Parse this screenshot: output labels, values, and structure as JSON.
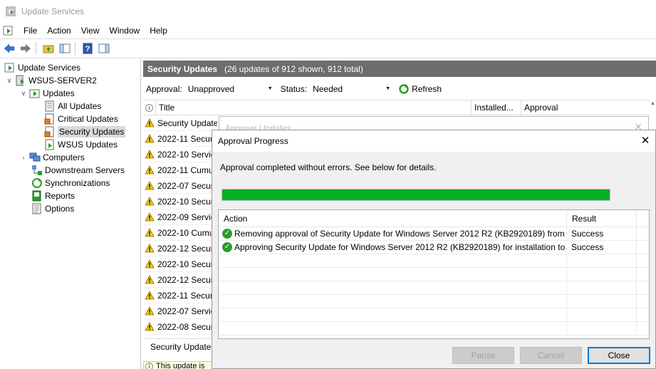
{
  "window": {
    "title": "Update Services"
  },
  "menu": [
    "File",
    "Action",
    "View",
    "Window",
    "Help"
  ],
  "toolbar": {
    "icons": [
      "back-arrow-icon",
      "forward-arrow-icon",
      "up-folder-icon",
      "show-hide-tree-icon",
      "help-icon",
      "show-hide-action-pane-icon"
    ]
  },
  "tree": {
    "root": "Update Services",
    "server": "WSUS-SERVER2",
    "updates": "Updates",
    "all_updates": "All Updates",
    "critical_updates": "Critical Updates",
    "security_updates": "Security Updates",
    "wsus_updates": "WSUS Updates",
    "computers": "Computers",
    "downstream": "Downstream Servers",
    "synchronizations": "Synchronizations",
    "reports": "Reports",
    "options": "Options"
  },
  "pane": {
    "title": "Security Updates",
    "subtitle": "(26 updates of 912 shown, 912 total)",
    "approval_label": "Approval:",
    "approval_value": "Unapproved",
    "status_label": "Status:",
    "status_value": "Needed",
    "refresh": "Refresh",
    "columns": {
      "title": "Title",
      "installed": "Installed...",
      "approval": "Approval"
    },
    "rows": [
      "Security Update",
      "2022-11 Security",
      "2022-10 Servicing",
      "2022-11 Cumulative",
      "2022-07 Security",
      "2022-10 Security",
      "2022-09 Servicing",
      "2022-10 Cumulative",
      "2022-12 Security",
      "2022-10 Security",
      "2022-12 Security",
      "2022-11 Security",
      "2022-07 Servicing",
      "2022-08 Security"
    ],
    "detail_title": "Security Update",
    "detail_info": "This update is"
  },
  "approve_dialog": {
    "title": "Approve Updates"
  },
  "progress_dialog": {
    "title": "Approval Progress",
    "message": "Approval completed without errors. See below for details.",
    "progress_percent": 100,
    "columns": {
      "action": "Action",
      "result": "Result"
    },
    "rows": [
      {
        "action": "Removing approval of Security Update for Windows Server 2012 R2 (KB2920189) from ...",
        "result": "Success"
      },
      {
        "action": "Approving Security Update for Windows Server 2012 R2 (KB2920189) for installation to ...",
        "result": "Success"
      }
    ],
    "buttons": {
      "pause": "Pause",
      "cancel": "Cancel",
      "close": "Close"
    }
  },
  "colors": {
    "progress": "#06b025",
    "header": "#6d6d6d",
    "accent": "#0078d7"
  }
}
